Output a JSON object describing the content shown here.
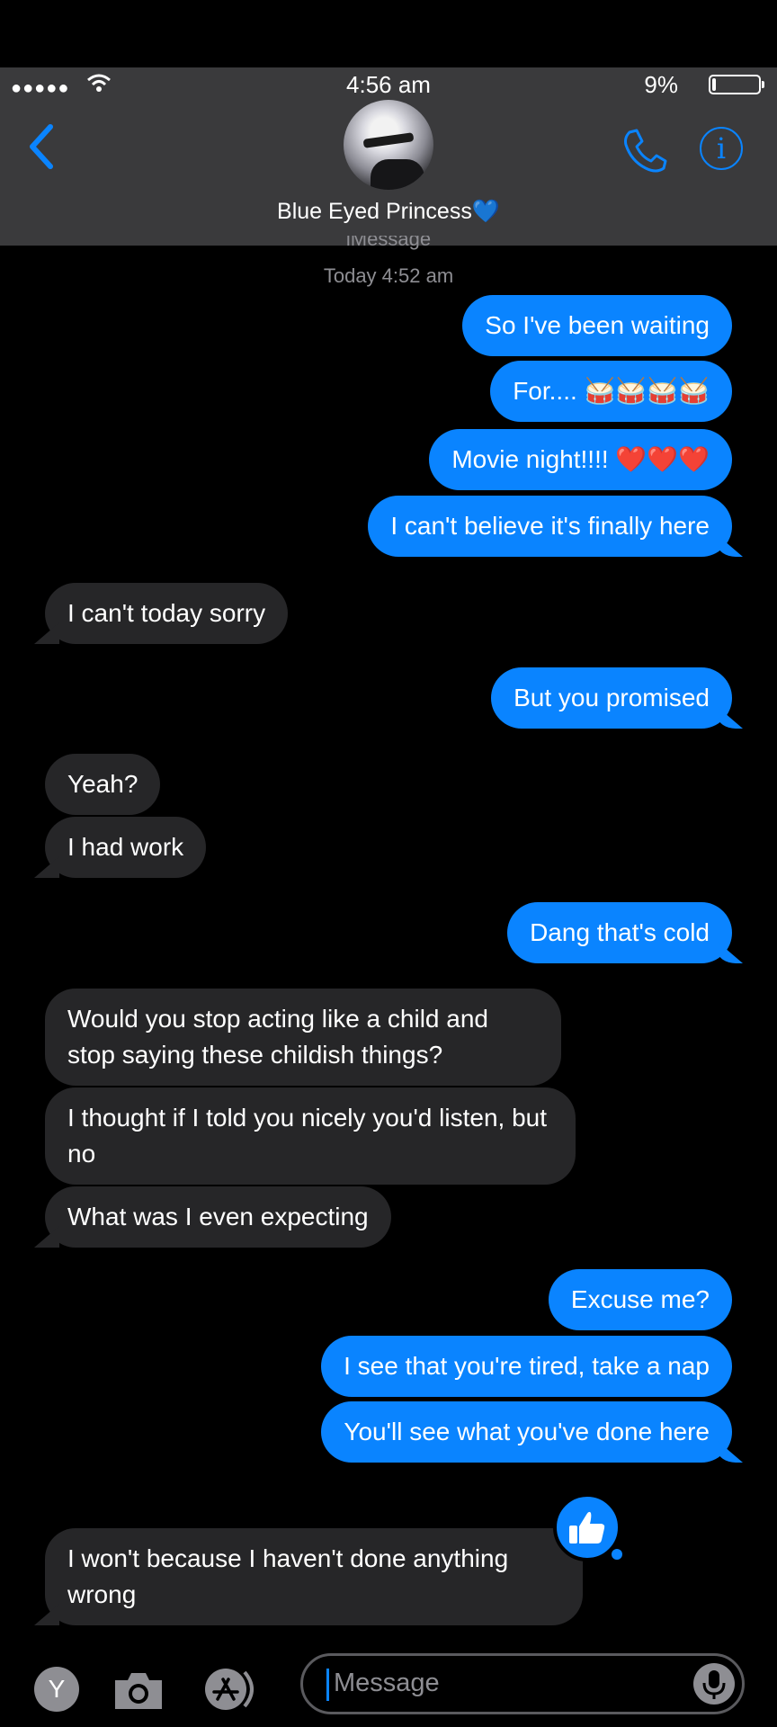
{
  "status": {
    "time": "4:56 am",
    "battery": "9%"
  },
  "header": {
    "contact_name": "Blue Eyed Princess💙"
  },
  "thread": {
    "service_label": "iMessage",
    "timestamp": "Today 4:52 am",
    "messages": [
      {
        "from": "me",
        "text": "So I've been waiting"
      },
      {
        "from": "me",
        "text": "For.... 🥁🥁🥁🥁"
      },
      {
        "from": "me",
        "text": "Movie night!!!! ❤️❤️❤️"
      },
      {
        "from": "me",
        "text": "I can't believe it's finally here"
      },
      {
        "from": "them",
        "text": "I can't today sorry"
      },
      {
        "from": "me",
        "text": "But you promised"
      },
      {
        "from": "them",
        "text": "Yeah?"
      },
      {
        "from": "them",
        "text": "I had work"
      },
      {
        "from": "me",
        "text": "Dang that's cold"
      },
      {
        "from": "them",
        "text": "Would you stop acting like a child and stop saying these childish things?"
      },
      {
        "from": "them",
        "text": "I thought if I told you nicely you'd listen, but no"
      },
      {
        "from": "them",
        "text": "What was I even expecting"
      },
      {
        "from": "me",
        "text": "Excuse me?"
      },
      {
        "from": "me",
        "text": "I see that you're tired, take a nap"
      },
      {
        "from": "me",
        "text": "You'll see what you've done here"
      },
      {
        "from": "them",
        "text": "I won't because I haven't done anything wrong",
        "reaction": "thumbs-up-icon"
      }
    ]
  },
  "composer": {
    "apps_button_letter": "Y",
    "placeholder": "Message"
  },
  "colors": {
    "sent": "#0a84ff",
    "received": "#262628",
    "header": "#3a3a3c"
  }
}
